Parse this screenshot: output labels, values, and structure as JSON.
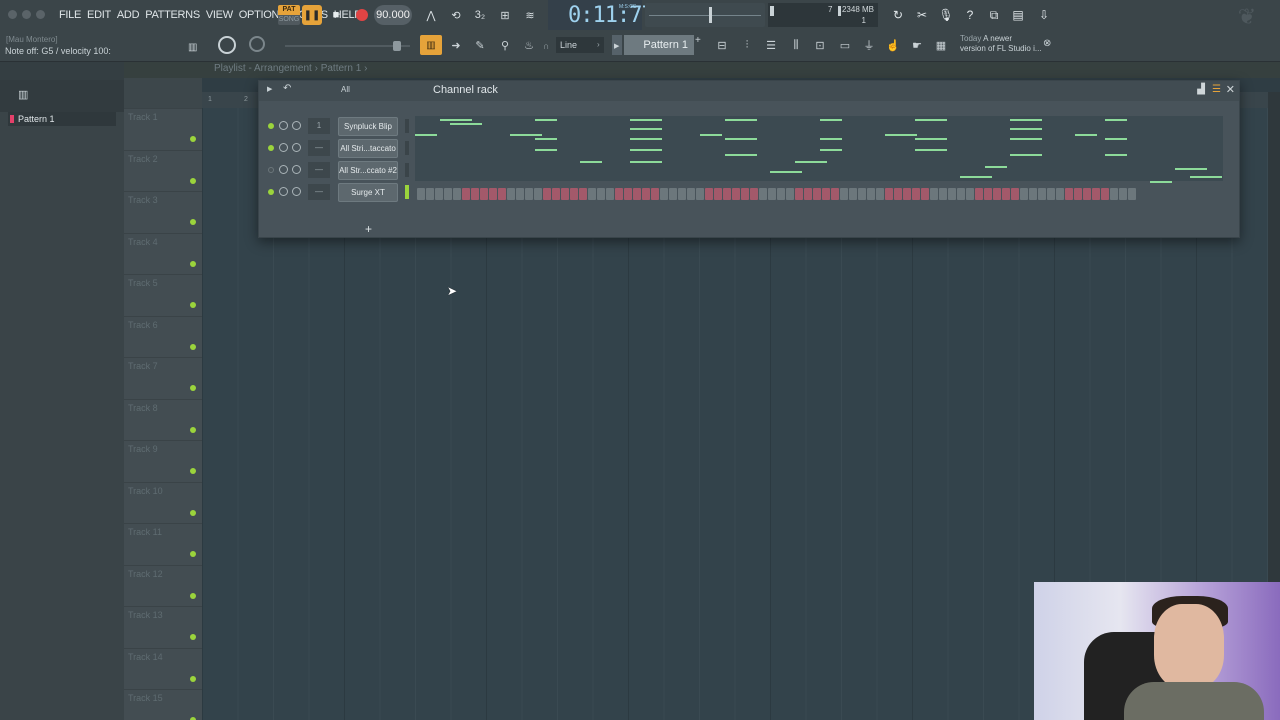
{
  "menu": [
    "FILE",
    "EDIT",
    "ADD",
    "PATTERNS",
    "VIEW",
    "OPTIONS",
    "TOOLS",
    "HELP"
  ],
  "hint": {
    "title": "[Mau Montero]",
    "text": "Note off: G5 / velocity 100:"
  },
  "transport": {
    "pat": "PAT",
    "song": "SONG",
    "tempo": "90.000",
    "time": "0:11:77",
    "time_unit": "M:S:CS"
  },
  "monitor": {
    "memory": "2348 MB",
    "voices": "7",
    "cpu_row": "1"
  },
  "toolbar2": {
    "snap_mode": "Line",
    "pattern": "Pattern 1"
  },
  "news": {
    "date": "Today",
    "text1": "A newer",
    "text2": "version of FL Studio i..."
  },
  "browser": {
    "pattern_item": "Pattern 1"
  },
  "playlist": {
    "crumb": "Playlist - Arrangement › Pattern 1 ›",
    "timeline_marks": [
      "1",
      "2"
    ]
  },
  "tracks": [
    "Track 1",
    "Track 2",
    "Track 3",
    "Track 4",
    "Track 5",
    "Track 6",
    "Track 7",
    "Track 8",
    "Track 9",
    "Track 10",
    "Track 11",
    "Track 12",
    "Track 13",
    "Track 14",
    "Track 15"
  ],
  "channel_rack": {
    "title": "Channel rack",
    "filter": "All",
    "channels": [
      {
        "name": "Synpluck Blip",
        "number": "1",
        "on": true
      },
      {
        "name": "All Stri...taccato",
        "number": "—",
        "on": true
      },
      {
        "name": "All Str...ccato #2",
        "number": "—",
        "on": false
      },
      {
        "name": "Surge XT",
        "number": "—",
        "on": true
      }
    ],
    "add": "+"
  },
  "colors": {
    "accent": "#e6a33a",
    "note": "#8ddb9a",
    "led": "#9bd43c",
    "record": "#e04444"
  }
}
